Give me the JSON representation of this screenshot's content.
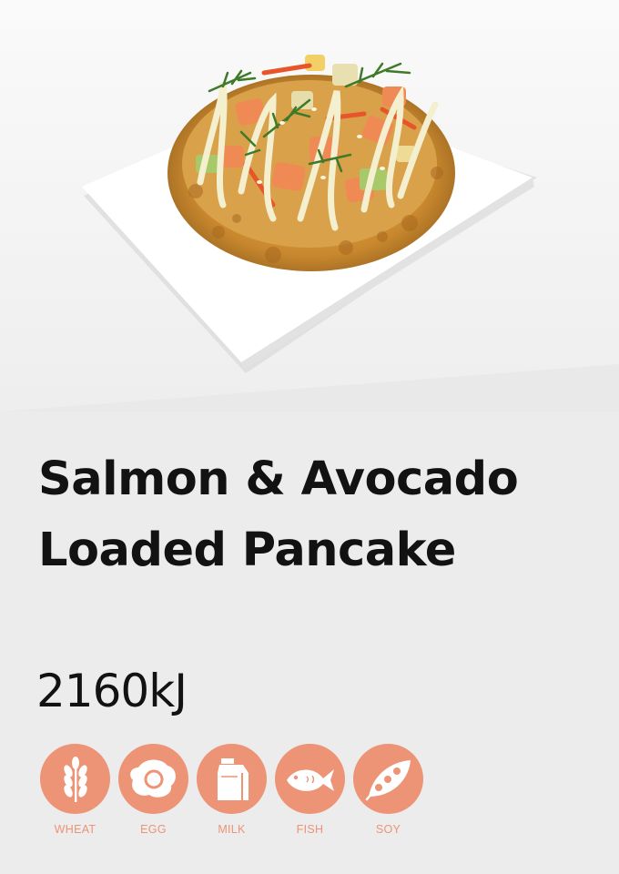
{
  "hero": {
    "image_alt": "Salmon and avocado loaded pancake on a white square plate"
  },
  "product": {
    "title_line1": "Salmon & Avocado",
    "title_line2": "Loaded Pancake",
    "energy": "2160kJ"
  },
  "colors": {
    "accent": "#ed9376",
    "text": "#121212",
    "background": "#ececec"
  },
  "allergens": [
    {
      "label": "WHEAT",
      "icon": "wheat-icon"
    },
    {
      "label": "EGG",
      "icon": "egg-icon"
    },
    {
      "label": "MILK",
      "icon": "milk-carton-icon"
    },
    {
      "label": "FISH",
      "icon": "fish-icon"
    },
    {
      "label": "SOY",
      "icon": "soy-pod-icon"
    }
  ]
}
